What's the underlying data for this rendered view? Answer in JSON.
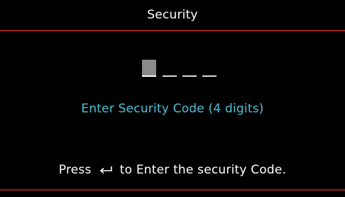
{
  "title": "Security",
  "code": {
    "digits_total": 4,
    "active_index": 0
  },
  "prompt": "Enter Security Code (4 digits)",
  "hint": {
    "before": "Press",
    "icon": "enter-return-icon",
    "after": "to Enter the security Code."
  },
  "colors": {
    "background": "#000000",
    "title_text": "#ffffff",
    "prompt_text": "#4ec0d6",
    "hint_text": "#ffffff",
    "separator": "#9b1b1b",
    "active_digit": "#8a8a8a"
  }
}
